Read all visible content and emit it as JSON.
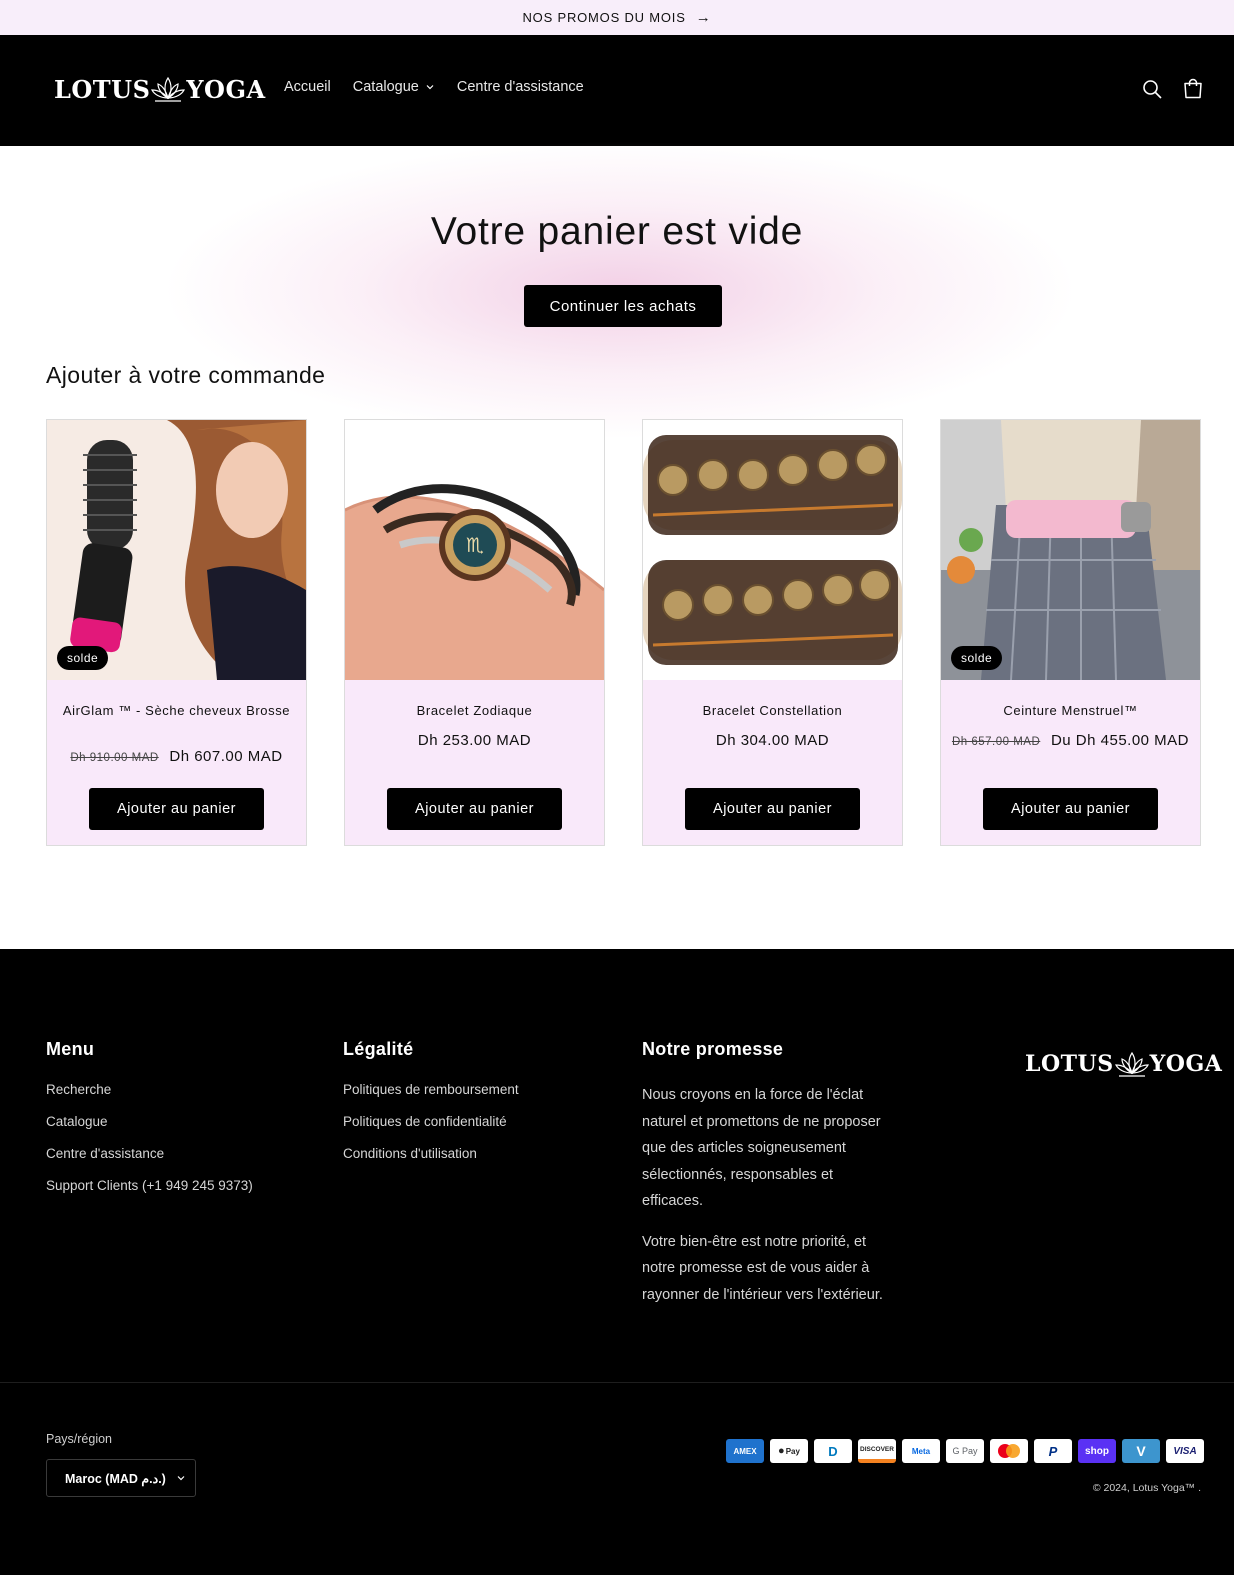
{
  "announcement": {
    "text": "NOS PROMOS DU MOIS",
    "arrow": "→"
  },
  "header": {
    "logo_left": "LOTUS",
    "logo_right": "YOGA",
    "nav": {
      "home": "Accueil",
      "catalog": "Catalogue",
      "help": "Centre d'assistance"
    },
    "icons": [
      "search-icon",
      "cart-icon"
    ]
  },
  "cart": {
    "empty_title": "Votre panier est vide",
    "continue_label": "Continuer les achats"
  },
  "upsell": {
    "title": "Ajouter à votre commande",
    "products": [
      {
        "name": "AirGlam ™ - Sèche cheveux Brosse",
        "old_price": "Dh 910.00 MAD",
        "price": "Dh 607.00 MAD",
        "badge": "solde",
        "button": "Ajouter au panier"
      },
      {
        "name": "Bracelet Zodiaque",
        "old_price": "",
        "price": "Dh 253.00 MAD",
        "badge": "",
        "button": "Ajouter au panier"
      },
      {
        "name": "Bracelet Constellation",
        "old_price": "",
        "price": "Dh 304.00 MAD",
        "badge": "",
        "button": "Ajouter au panier"
      },
      {
        "name": "Ceinture Menstruel™",
        "old_price": "Dh 657.00 MAD",
        "price": "Du Dh 455.00 MAD",
        "badge": "solde",
        "button": "Ajouter au panier"
      }
    ]
  },
  "footer": {
    "menu": {
      "title": "Menu",
      "links": [
        "Recherche",
        "Catalogue",
        "Centre d'assistance",
        "Support Clients (+1 949 245 9373)"
      ]
    },
    "legal": {
      "title": "Légalité",
      "links": [
        "Politiques de remboursement",
        "Politiques de confidentialité",
        "Conditions d'utilisation"
      ]
    },
    "promise": {
      "title": "Notre promesse",
      "paragraphs": [
        "Nous croyons en la force de l'éclat naturel et promettons de ne proposer que des articles soigneusement sélectionnés, responsables et efficaces.",
        "Votre bien-être est notre priorité, et notre promesse est de vous aider à rayonner de l'intérieur vers l'extérieur."
      ]
    },
    "country_label": "Pays/région",
    "country_value": "Maroc (MAD د.م.)",
    "payments": [
      "American Express",
      "Apple Pay",
      "Diners Club",
      "Discover",
      "Meta Pay",
      "Google Pay",
      "Mastercard",
      "PayPal",
      "Shop Pay",
      "Venmo",
      "Visa"
    ],
    "payment_labels": [
      "AMEX",
      "Pay",
      "D",
      "DISCOVER",
      "Meta",
      "G Pay",
      "",
      "P",
      "shop",
      "V",
      "VISA"
    ],
    "copyright": "© 2024, Lotus Yoga™ ."
  },
  "colors": {
    "announcement_bg": "#f8eefa",
    "card_bg": "#f9e9fa",
    "header_bg": "#000000",
    "accent_pink": "#e8aad2"
  }
}
